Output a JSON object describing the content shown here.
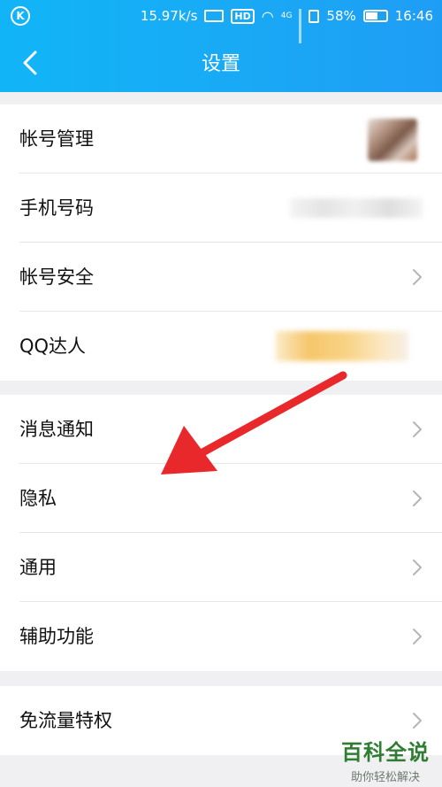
{
  "statusbar": {
    "speed": "15.97k/s",
    "hd": "HD",
    "network": "4G",
    "battery": "58%",
    "time": "16:46"
  },
  "navbar": {
    "back_icon": "chevron-left-icon",
    "title": "设置"
  },
  "group1": [
    {
      "label": "帐号管理"
    },
    {
      "label": "手机号码"
    },
    {
      "label": "帐号安全"
    },
    {
      "label": "QQ达人"
    }
  ],
  "group2": [
    {
      "label": "消息通知"
    },
    {
      "label": "隐私"
    },
    {
      "label": "通用"
    },
    {
      "label": "辅助功能"
    }
  ],
  "group3": [
    {
      "label": "免流量特权"
    }
  ],
  "colors": {
    "header": "#1aa8f5",
    "arrow": "#e8282a",
    "watermark": "#2e7d32"
  },
  "watermark": {
    "title": "百科全说",
    "subtitle": "助你轻松解决"
  }
}
